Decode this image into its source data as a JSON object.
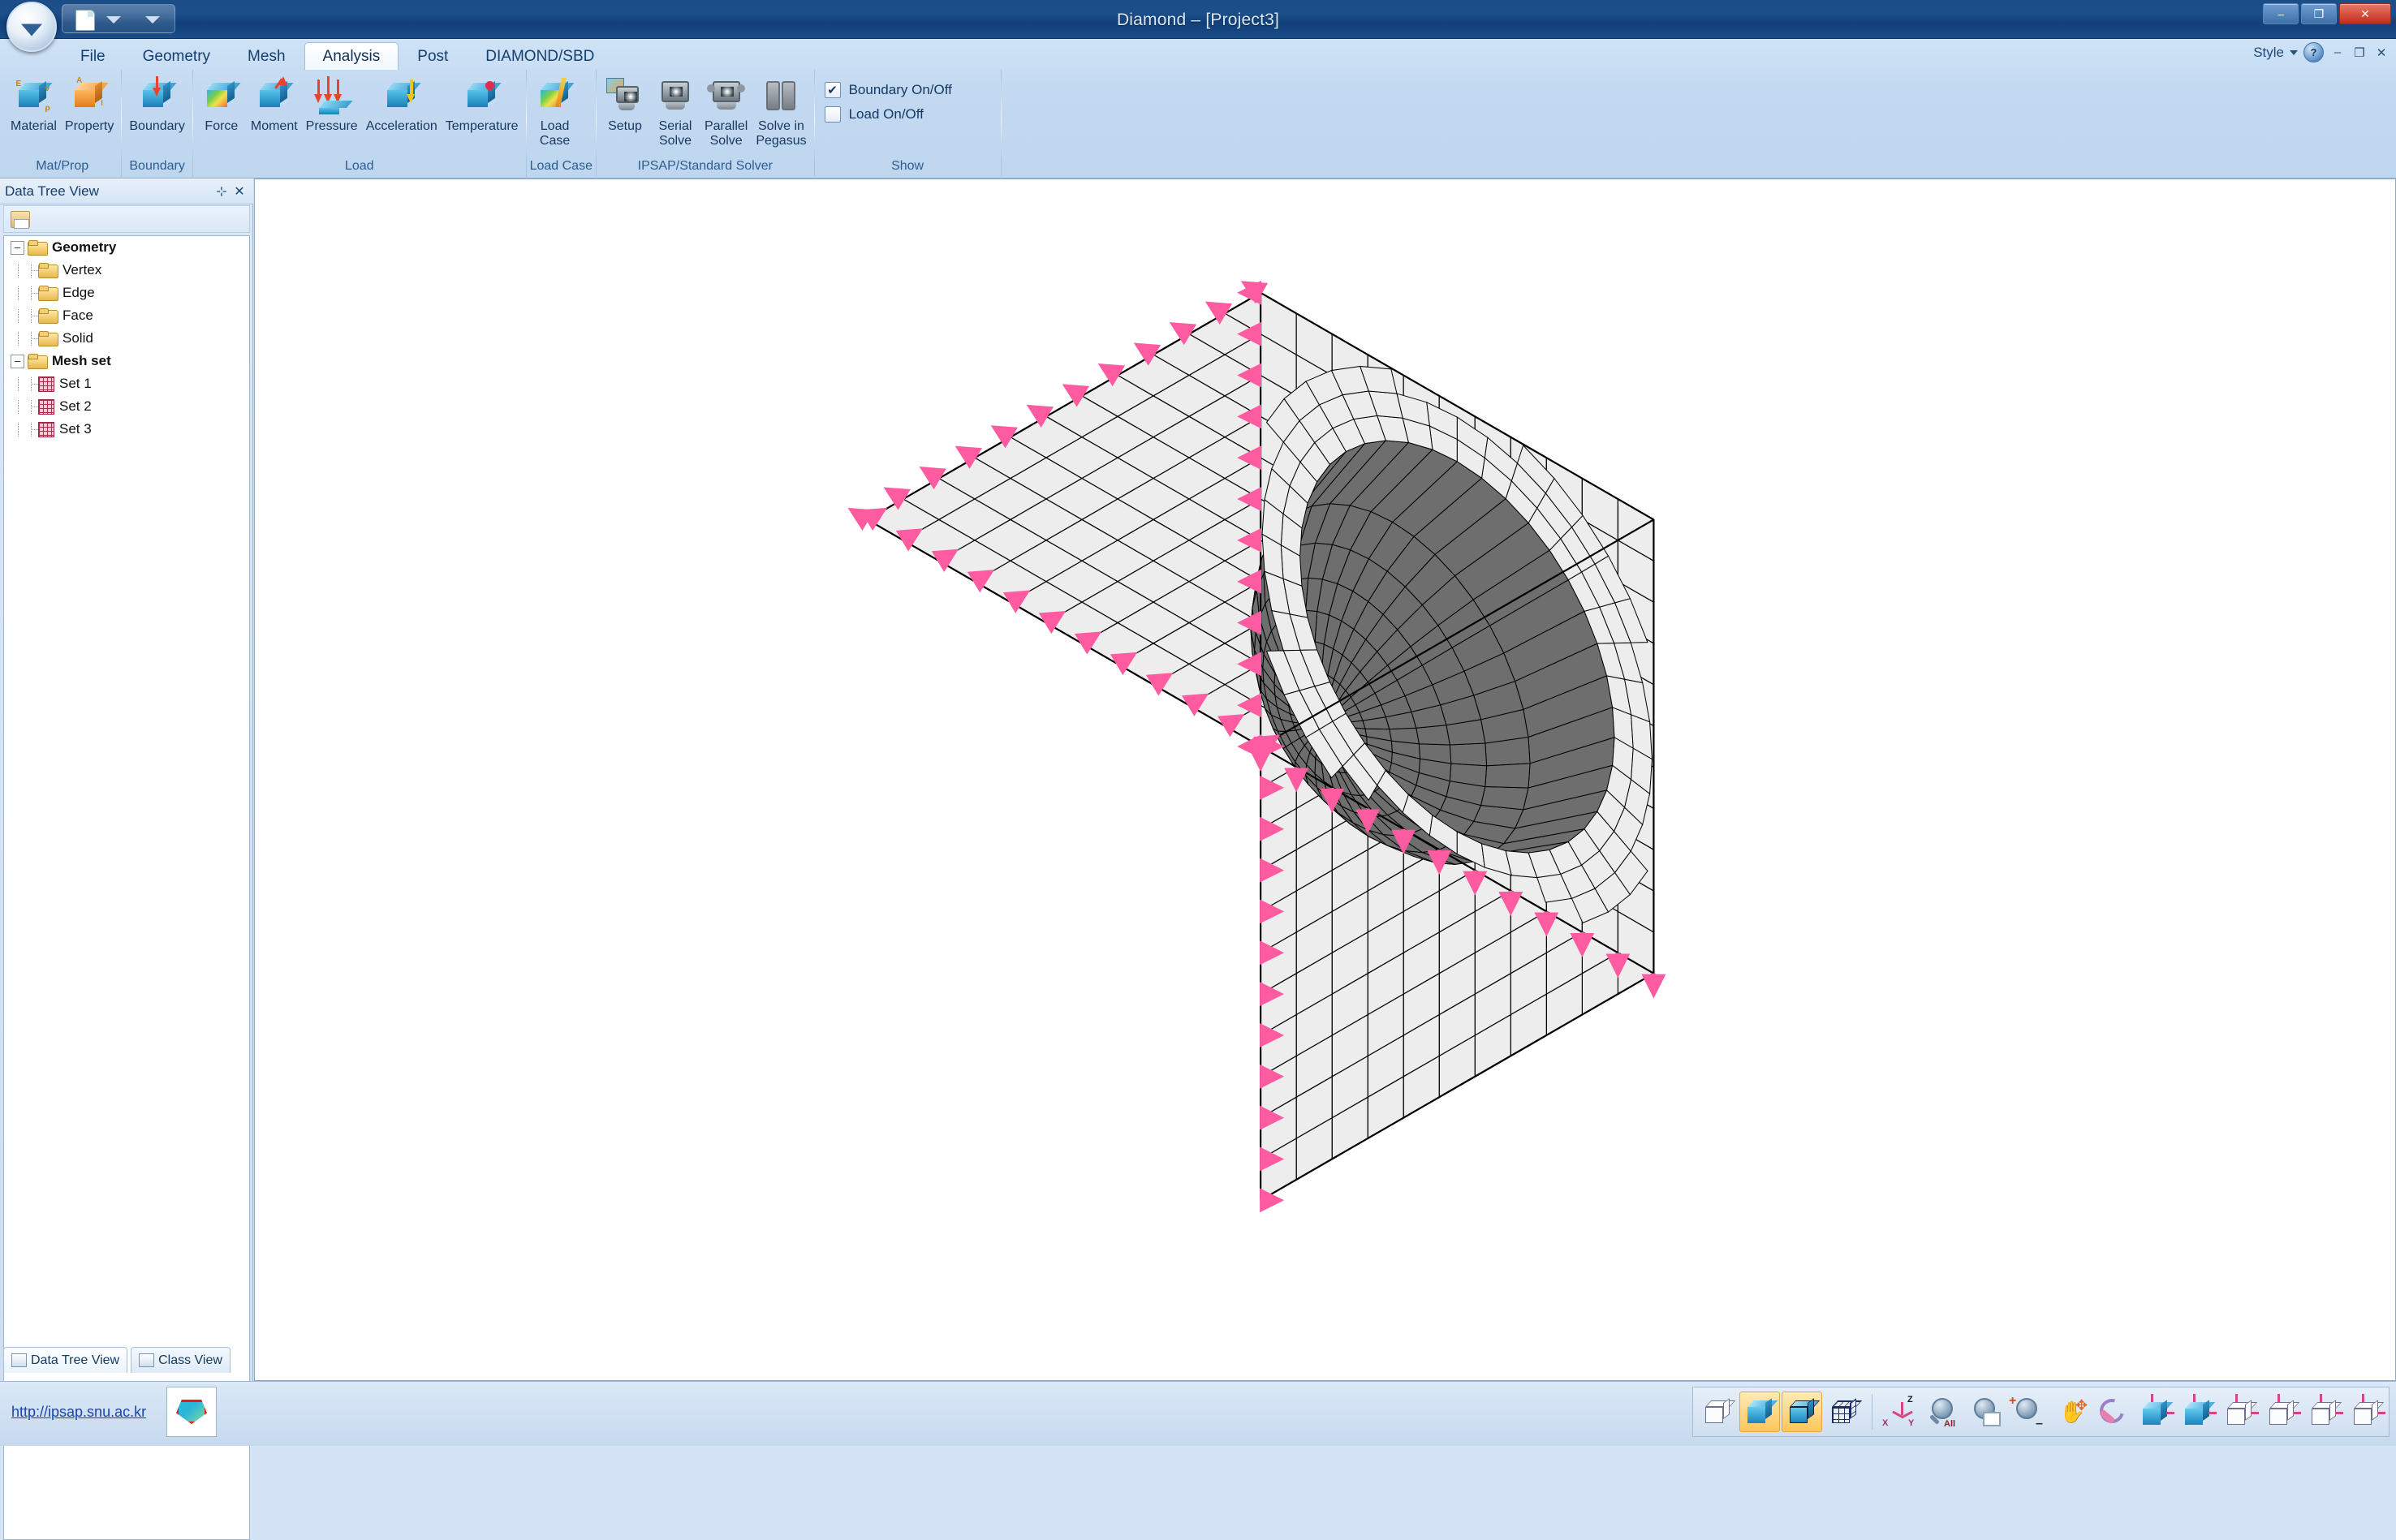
{
  "window": {
    "title": "Diamond – [Project3]",
    "minimize": "–",
    "maximize": "❐",
    "close": "✕"
  },
  "quick_access": {
    "orb_label": "Diamond menu",
    "items": [
      "new-document",
      "quick-print",
      "customize"
    ]
  },
  "ribbon": {
    "tabs": [
      {
        "label": "File",
        "active": false
      },
      {
        "label": "Geometry",
        "active": false
      },
      {
        "label": "Mesh",
        "active": false
      },
      {
        "label": "Analysis",
        "active": true
      },
      {
        "label": "Post",
        "active": false
      },
      {
        "label": "DIAMOND/SBD",
        "active": false
      }
    ],
    "style_menu": {
      "label": "Style",
      "arrow": "▾",
      "help": "?",
      "minimize": "–",
      "restore": "❐",
      "close": "✕"
    },
    "groups": [
      {
        "title": "Mat/Prop",
        "items": [
          {
            "label": "Material",
            "icon": "material-cube-icon"
          },
          {
            "label": "Property",
            "icon": "property-cube-icon"
          }
        ]
      },
      {
        "title": "Boundary",
        "items": [
          {
            "label": "Boundary",
            "icon": "boundary-cube-icon"
          }
        ]
      },
      {
        "title": "Load",
        "items": [
          {
            "label": "Force",
            "icon": "force-cube-icon"
          },
          {
            "label": "Moment",
            "icon": "moment-cube-icon"
          },
          {
            "label": "Pressure",
            "icon": "pressure-arrows-icon"
          },
          {
            "label": "Acceleration",
            "icon": "acceleration-cube-icon"
          },
          {
            "label": "Temperature",
            "icon": "temperature-cube-icon"
          }
        ]
      },
      {
        "title": "Load Case",
        "items": [
          {
            "label": "Load\nCase",
            "icon": "load-case-icon"
          }
        ]
      },
      {
        "title": "IPSAP/Standard Solver",
        "items": [
          {
            "label": "Setup",
            "icon": "solver-setup-icon"
          },
          {
            "label": "Serial\nSolve",
            "icon": "serial-solve-icon"
          },
          {
            "label": "Parallel\nSolve",
            "icon": "parallel-solve-icon"
          },
          {
            "label": "Solve in\nPegasus",
            "icon": "pegasus-solve-icon"
          }
        ]
      },
      {
        "title": "Show",
        "checkboxes": [
          {
            "label": "Boundary On/Off",
            "checked": true,
            "mark": "✔"
          },
          {
            "label": "Load On/Off",
            "checked": false,
            "mark": ""
          }
        ]
      }
    ]
  },
  "dock": {
    "caption": "Data Tree View",
    "pin": "⊹",
    "close": "✕",
    "toolbar_icon": "new-item-icon",
    "tree": [
      {
        "label": "Geometry",
        "level": 0,
        "icon": "folder-icon",
        "expander": "−",
        "bold": true
      },
      {
        "label": "Vertex",
        "level": 1,
        "icon": "folder-icon",
        "expander": "",
        "bold": false
      },
      {
        "label": "Edge",
        "level": 1,
        "icon": "folder-icon",
        "expander": "",
        "bold": false
      },
      {
        "label": "Face",
        "level": 1,
        "icon": "folder-icon",
        "expander": "",
        "bold": false
      },
      {
        "label": "Solid",
        "level": 1,
        "icon": "folder-icon",
        "expander": "",
        "bold": false
      },
      {
        "label": "Mesh set",
        "level": 0,
        "icon": "folder-icon",
        "expander": "−",
        "bold": true
      },
      {
        "label": "Set 1",
        "level": 1,
        "icon": "mesh-grid-icon",
        "expander": "",
        "bold": false
      },
      {
        "label": "Set 2",
        "level": 1,
        "icon": "mesh-grid-icon",
        "expander": "",
        "bold": false
      },
      {
        "label": "Set 3",
        "level": 1,
        "icon": "mesh-grid-icon",
        "expander": "",
        "bold": false
      }
    ],
    "tabs": [
      {
        "label": "Data Tree View",
        "active": true
      },
      {
        "label": "Class View",
        "active": false
      }
    ]
  },
  "viewport": {
    "model": "meshed-cube-with-spherical-cavity",
    "background": "#ffffff",
    "mesh_line_color": "#000000",
    "outer_face_color": "#ededed",
    "cavity_face_color": "#6e6e6e",
    "boundary_arrow_color": "#ff5ba0"
  },
  "statusbar": {
    "url": "http://ipsap.snu.ac.kr",
    "brand_button": "diamond-logo-button",
    "view_tools": [
      {
        "name": "wireframe-view",
        "active": false
      },
      {
        "name": "shaded-view",
        "active": true
      },
      {
        "name": "shaded-with-mesh-view",
        "active": true
      },
      {
        "name": "mesh-view",
        "active": false
      },
      {
        "name": "axis-triad",
        "active": false
      },
      {
        "name": "zoom-all",
        "active": false
      },
      {
        "name": "zoom-window",
        "active": false
      },
      {
        "name": "zoom-out",
        "active": false
      },
      {
        "name": "pan-view",
        "active": false
      },
      {
        "name": "rotate-view",
        "active": false
      },
      {
        "name": "iso-view",
        "active": false
      },
      {
        "name": "front-view",
        "active": false
      },
      {
        "name": "back-view",
        "active": false
      },
      {
        "name": "top-view",
        "active": false
      },
      {
        "name": "bottom-view",
        "active": false
      },
      {
        "name": "right-view",
        "active": false
      }
    ],
    "axis_labels": {
      "z": "Z",
      "x": "X",
      "y": "Y",
      "all": "All",
      "minus": "–",
      "plus": "+"
    }
  }
}
